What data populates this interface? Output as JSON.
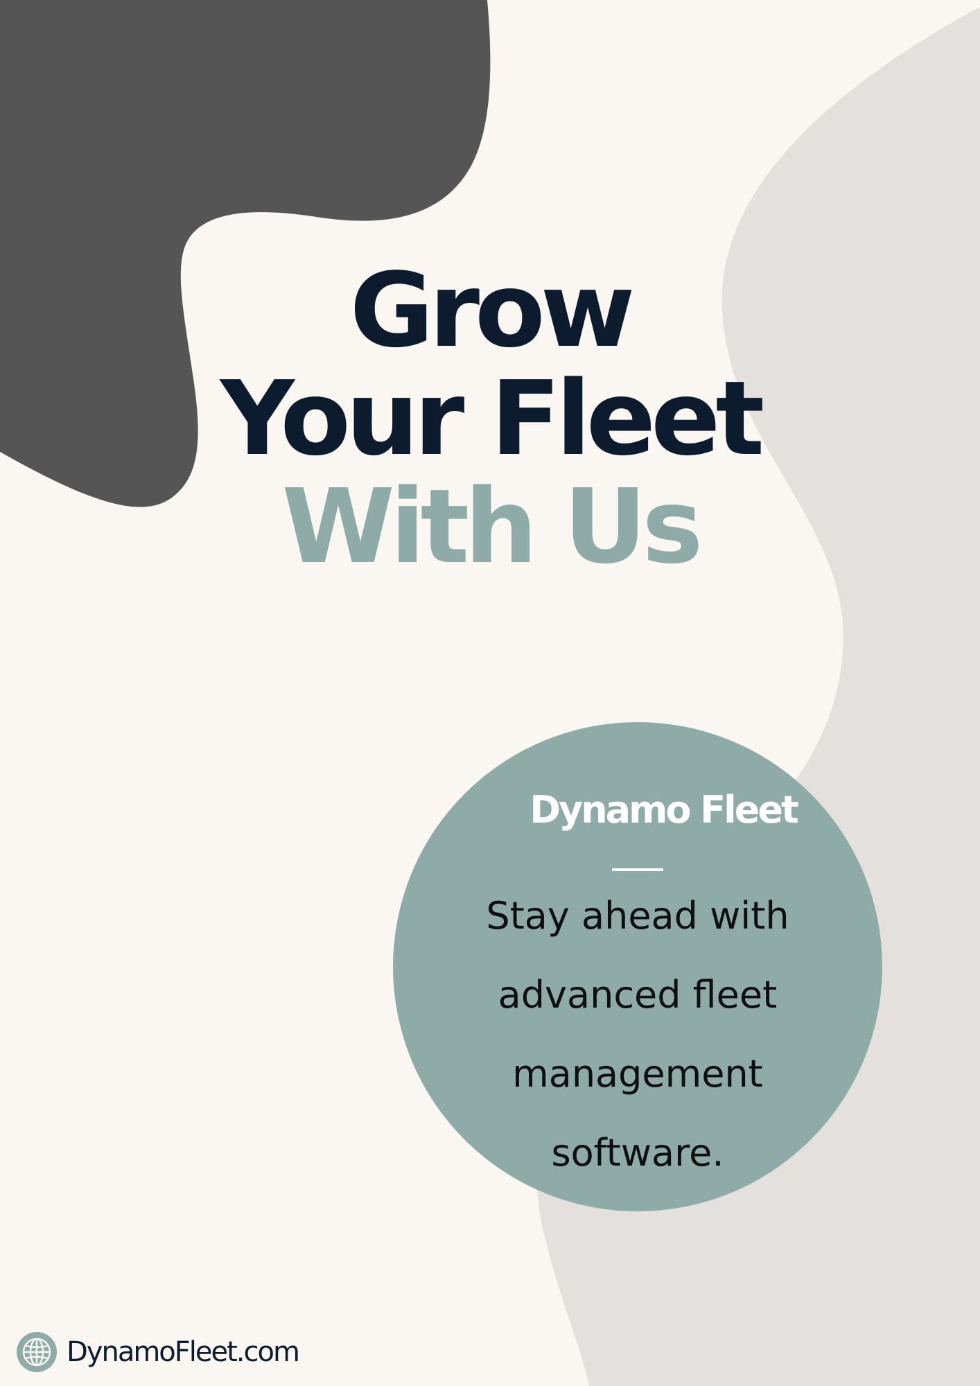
{
  "colors": {
    "background": "#faf7f3",
    "dark_blob": "#555555",
    "light_blob": "#e3e0de",
    "navy": "#0c1b2d",
    "sage": "#8eaba8",
    "white": "#ffffff"
  },
  "headline": {
    "line_1": "Grow",
    "line_2": "Your Fleet",
    "line_3": "With Us"
  },
  "badge": {
    "brand_name": "Dynamo Fleet",
    "tagline_lines": [
      "Stay ahead with",
      "advanced fleet",
      "management",
      "software."
    ]
  },
  "footer": {
    "icon": "globe-icon",
    "url": "DynamoFleet.com"
  }
}
